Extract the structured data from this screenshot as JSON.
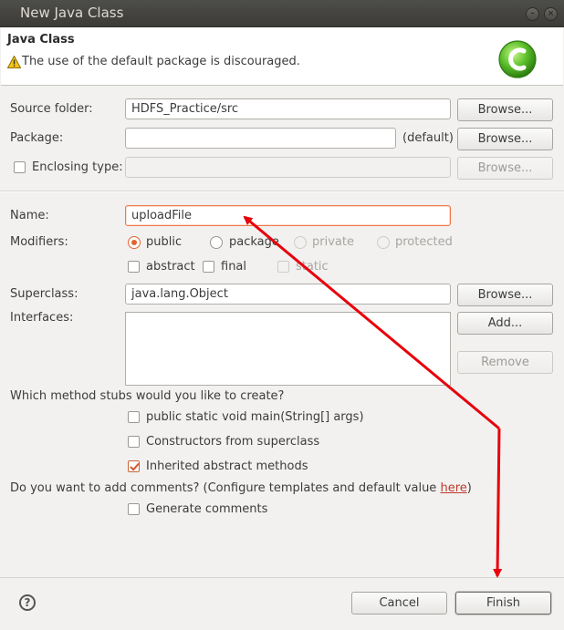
{
  "window": {
    "title": "New Java Class"
  },
  "header": {
    "title": "Java Class",
    "message": "The use of the default package is discouraged.",
    "warning_icon": "warning-icon",
    "logo_icon": "new-class-logo-icon"
  },
  "source_folder": {
    "label": "Source folder:",
    "value": "HDFS_Practice/src",
    "browse": "Browse..."
  },
  "package": {
    "label": "Package:",
    "value": "",
    "default_note": "(default)",
    "browse": "Browse..."
  },
  "enclosing_type": {
    "label": "Enclosing type:",
    "value": "",
    "browse": "Browse...",
    "checked": false
  },
  "name": {
    "label": "Name:",
    "value": "uploadFile"
  },
  "modifiers": {
    "label": "Modifiers:",
    "radios": [
      "public",
      "package",
      "private",
      "protected"
    ],
    "selected": "public",
    "checks": [
      "abstract",
      "final",
      "static"
    ]
  },
  "superclass": {
    "label": "Superclass:",
    "value": "java.lang.Object",
    "browse": "Browse..."
  },
  "interfaces": {
    "label": "Interfaces:",
    "add": "Add...",
    "remove": "Remove"
  },
  "stubs": {
    "question": "Which method stubs would you like to create?",
    "options": [
      {
        "label": "public static void main(String[] args)",
        "checked": false
      },
      {
        "label": "Constructors from superclass",
        "checked": false
      },
      {
        "label": "Inherited abstract methods",
        "checked": true
      }
    ]
  },
  "comments": {
    "question_prefix": "Do you want to add comments? (Configure templates and default value ",
    "link": "here",
    "question_suffix": ")",
    "option": "Generate comments"
  },
  "footer": {
    "cancel": "Cancel",
    "finish": "Finish",
    "help_icon": "help-icon"
  },
  "colors": {
    "accent": "#e2652f",
    "annotation_arrow": "#e8000b"
  }
}
